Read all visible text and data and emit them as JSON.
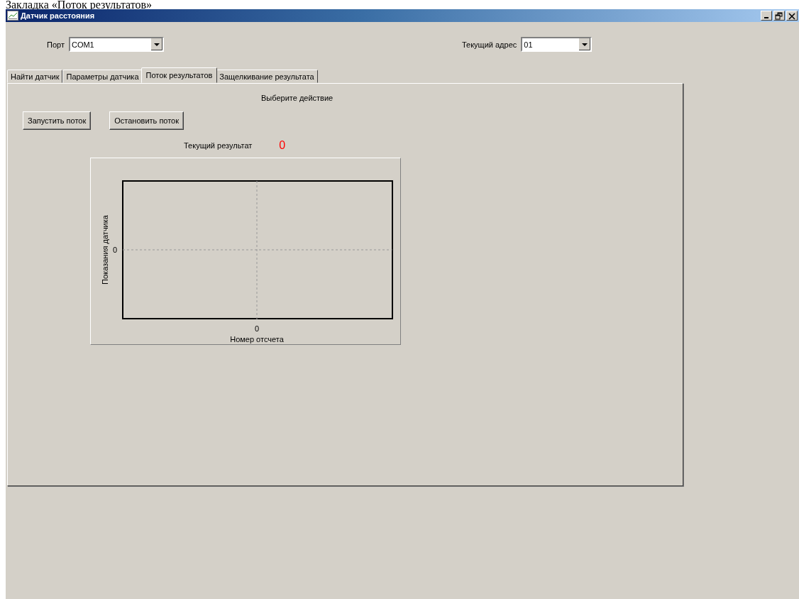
{
  "caption": "Закладка «Поток результатов»",
  "window": {
    "title": "Датчик расстояния"
  },
  "port": {
    "label": "Порт",
    "value": "COM1"
  },
  "address": {
    "label": "Текущий адрес",
    "value": "01"
  },
  "tabs": [
    {
      "label": "Найти датчик",
      "selected": false
    },
    {
      "label": "Параметры датчика",
      "selected": false
    },
    {
      "label": "Поток результатов",
      "selected": true
    },
    {
      "label": "Защелкивание результата",
      "selected": false
    }
  ],
  "prompt": "Выберите действие",
  "buttons": [
    "Запустить поток",
    "Остановить поток"
  ],
  "result": {
    "label": "Текущий результат",
    "value": "0"
  },
  "plot": {
    "ylabel": "Показания датчика",
    "xlabel": "Номер отсчета",
    "ytick": "0",
    "xtick": "0"
  }
}
